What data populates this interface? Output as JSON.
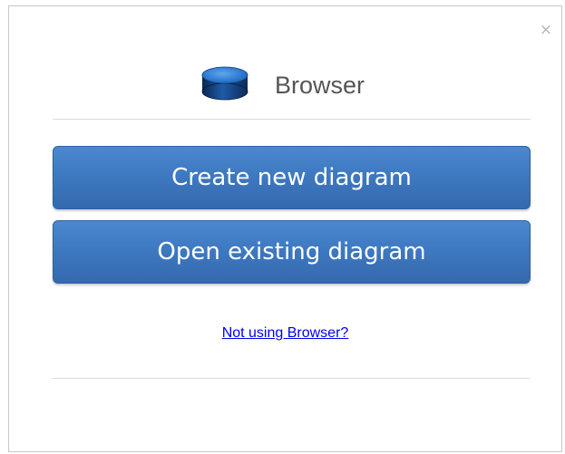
{
  "dialog": {
    "close_label": "×",
    "title": "Browser",
    "icon": "database-icon",
    "buttons": {
      "create_label": "Create new diagram",
      "open_label": "Open existing diagram"
    },
    "link_label": "Not using Browser?"
  },
  "colors": {
    "button_top": "#4a88cf",
    "button_bottom": "#3569ae",
    "button_text": "#ffffff",
    "title_text": "#555555",
    "link": "#0000ee",
    "divider": "#dcdcdc",
    "icon_dark": "#0b2a55",
    "icon_light": "#2f7bd0"
  }
}
